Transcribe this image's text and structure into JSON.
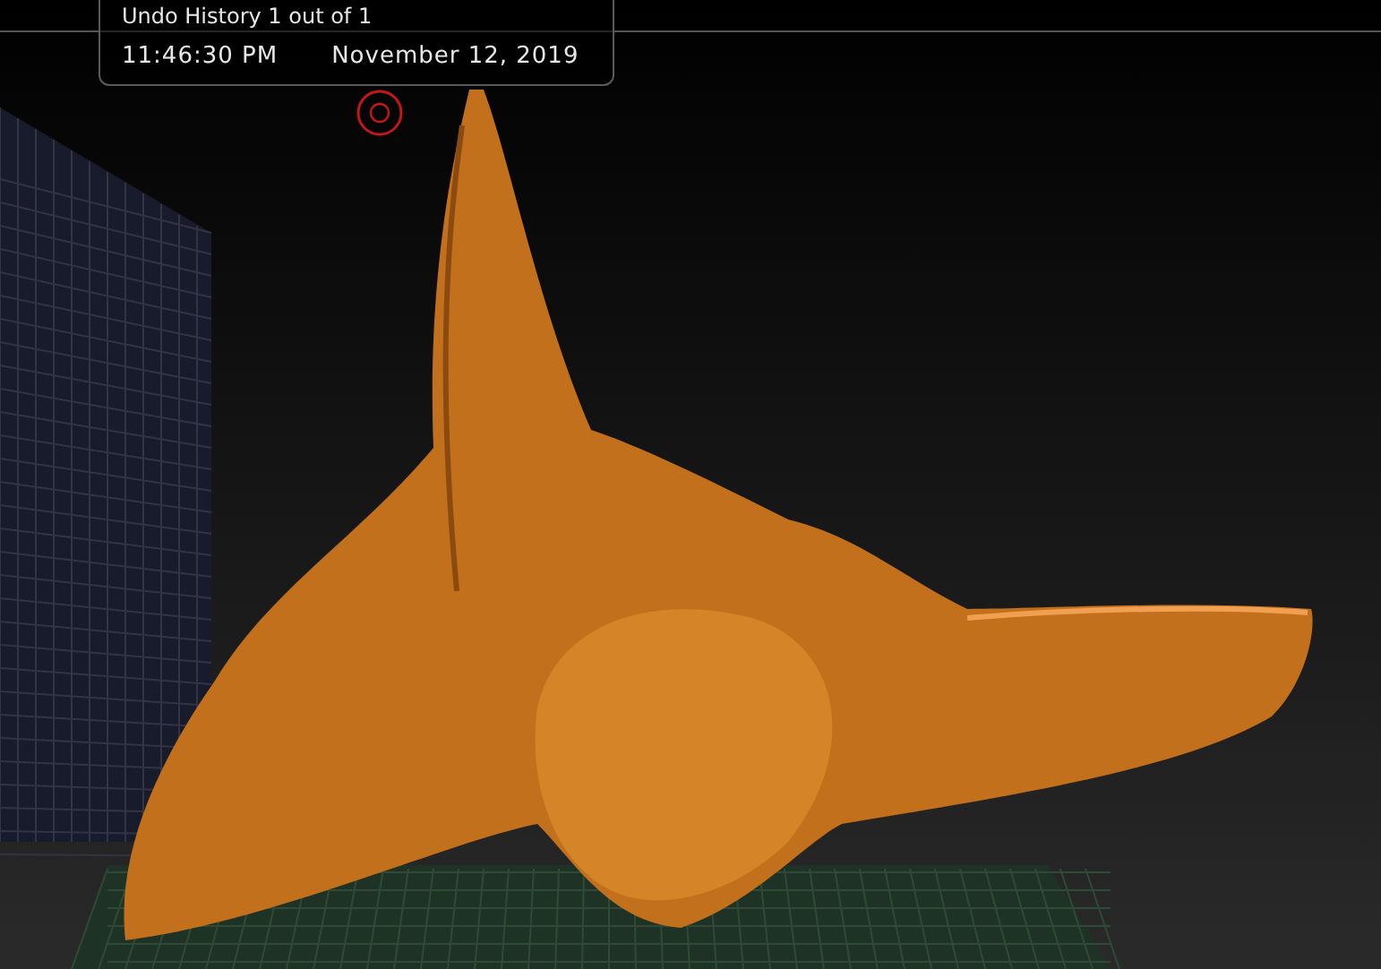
{
  "tooltip": {
    "title": "Undo History 1 out of 1",
    "time": "11:46:30 PM",
    "date": "November 12, 2019"
  }
}
